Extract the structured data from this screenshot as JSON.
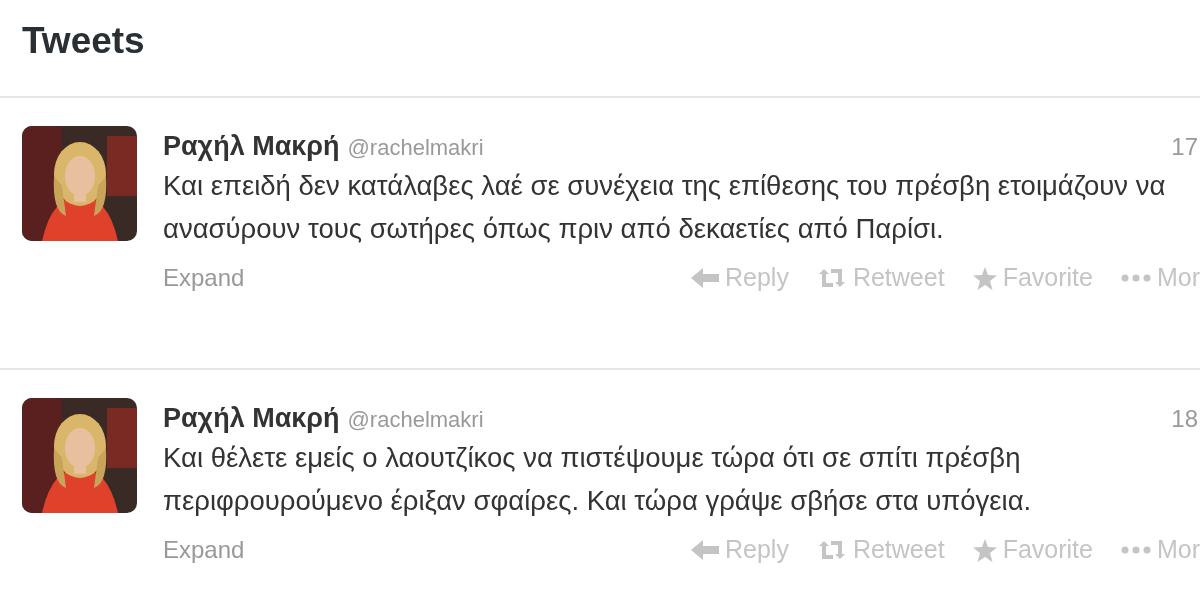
{
  "header": {
    "title": "Tweets"
  },
  "tweets": [
    {
      "name": "Ραχήλ Μακρή",
      "handle": "@rachelmakri",
      "time": "17",
      "text": "Και επειδή δεν κατάλαβες λαέ σε συνέχεια της επίθεσης του πρέσβη ετοιμάζουν να ανασύρουν τους σωτήρες όπως πριν από δεκαετίες από Παρίσι.",
      "expand": "Expand",
      "actions": [
        {
          "kind": "reply",
          "label": "Reply"
        },
        {
          "kind": "retweet",
          "label": "Retweet"
        },
        {
          "kind": "favorite",
          "label": "Favorite"
        },
        {
          "kind": "more",
          "label": "Mor"
        }
      ]
    },
    {
      "name": "Ραχήλ Μακρή",
      "handle": "@rachelmakri",
      "time": "18",
      "text": "Και θέλετε εμείς ο λαουτζίκος να πιστέψουμε τώρα ότι σε σπίτι πρέσβη περιφρουρούμενο έριξαν σφαίρες. Και τώρα γράψε σβήσε στα υπόγεια.",
      "expand": "Expand",
      "actions": [
        {
          "kind": "reply",
          "label": "Reply"
        },
        {
          "kind": "retweet",
          "label": "Retweet"
        },
        {
          "kind": "favorite",
          "label": "Favorite"
        },
        {
          "kind": "more",
          "label": "Mor"
        }
      ]
    }
  ]
}
